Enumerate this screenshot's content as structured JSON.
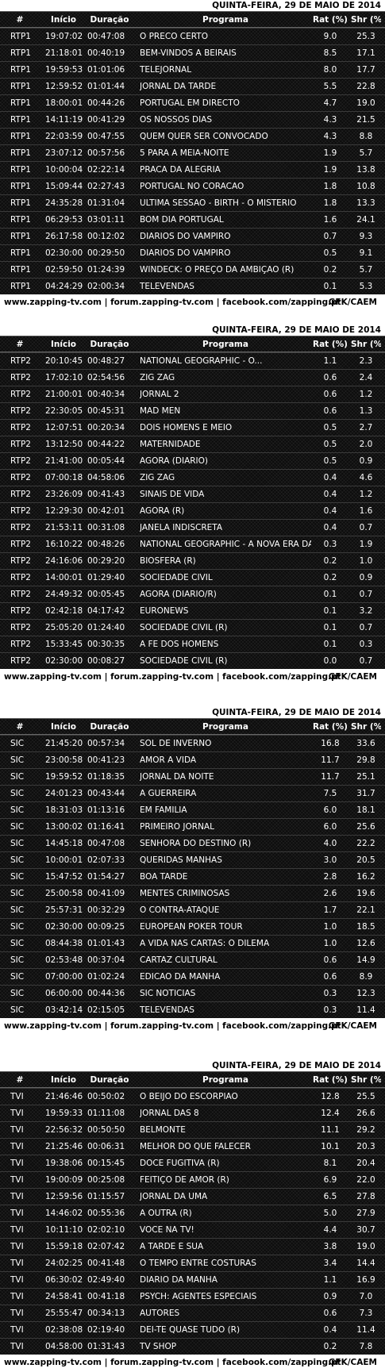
{
  "columns": {
    "num": "#",
    "inicio": "Início",
    "duracao": "Duração",
    "programa": "Programa",
    "rat": "Rat (%)",
    "shr": "Shr (%)"
  },
  "footer": {
    "links": "www.zapping-tv.com | forum.zapping-tv.com | facebook.com/zapping.pt",
    "source": "GFK/CAEM"
  },
  "blocks": [
    {
      "date": "QUINTA-FEIRA, 29 DE MAIO DE 2014",
      "rows": [
        {
          "ch": "RTP1",
          "in": "19:07:02",
          "du": "00:47:08",
          "pr": "O PRECO CERTO",
          "ra": "9.0",
          "sh": "25.3"
        },
        {
          "ch": "RTP1",
          "in": "21:18:01",
          "du": "00:40:19",
          "pr": "BEM-VINDOS A BEIRAIS",
          "ra": "8.5",
          "sh": "17.1"
        },
        {
          "ch": "RTP1",
          "in": "19:59:53",
          "du": "01:01:06",
          "pr": "TELEJORNAL",
          "ra": "8.0",
          "sh": "17.7"
        },
        {
          "ch": "RTP1",
          "in": "12:59:52",
          "du": "01:01:44",
          "pr": "JORNAL DA TARDE",
          "ra": "5.5",
          "sh": "22.8"
        },
        {
          "ch": "RTP1",
          "in": "18:00:01",
          "du": "00:44:26",
          "pr": "PORTUGAL EM DIRECTO",
          "ra": "4.7",
          "sh": "19.0"
        },
        {
          "ch": "RTP1",
          "in": "14:11:19",
          "du": "00:41:29",
          "pr": "OS NOSSOS DIAS",
          "ra": "4.3",
          "sh": "21.5"
        },
        {
          "ch": "RTP1",
          "in": "22:03:59",
          "du": "00:47:55",
          "pr": "QUEM QUER SER CONVOCADO",
          "ra": "4.3",
          "sh": "8.8"
        },
        {
          "ch": "RTP1",
          "in": "23:07:12",
          "du": "00:57:56",
          "pr": "5 PARA A MEIA-NOITE",
          "ra": "1.9",
          "sh": "5.7"
        },
        {
          "ch": "RTP1",
          "in": "10:00:04",
          "du": "02:22:14",
          "pr": "PRACA DA ALEGRIA",
          "ra": "1.9",
          "sh": "13.8"
        },
        {
          "ch": "RTP1",
          "in": "15:09:44",
          "du": "02:27:43",
          "pr": "PORTUGAL NO CORACAO",
          "ra": "1.8",
          "sh": "10.8"
        },
        {
          "ch": "RTP1",
          "in": "24:35:28",
          "du": "01:31:04",
          "pr": "ULTIMA SESSAO - BIRTH - O MISTERIO",
          "ra": "1.8",
          "sh": "13.3"
        },
        {
          "ch": "RTP1",
          "in": "06:29:53",
          "du": "03:01:11",
          "pr": "BOM DIA PORTUGAL",
          "ra": "1.6",
          "sh": "24.1"
        },
        {
          "ch": "RTP1",
          "in": "26:17:58",
          "du": "00:12:02",
          "pr": "DIARIOS DO VAMPIRO",
          "ra": "0.7",
          "sh": "9.3"
        },
        {
          "ch": "RTP1",
          "in": "02:30:00",
          "du": "00:29:50",
          "pr": "DIARIOS DO VAMPIRO",
          "ra": "0.5",
          "sh": "9.1"
        },
        {
          "ch": "RTP1",
          "in": "02:59:50",
          "du": "01:24:39",
          "pr": "WINDECK: O PREÇO DA AMBIÇAO (R)",
          "ra": "0.2",
          "sh": "5.7"
        },
        {
          "ch": "RTP1",
          "in": "04:24:29",
          "du": "02:00:34",
          "pr": "TELEVENDAS",
          "ra": "0.1",
          "sh": "5.3"
        }
      ]
    },
    {
      "date": "QUINTA-FEIRA, 29 DE MAIO DE 2014",
      "rows": [
        {
          "ch": "RTP2",
          "in": "20:10:45",
          "du": "00:48:27",
          "pr": "NATIONAL GEOGRAPHIC - O...",
          "ra": "1.1",
          "sh": "2.3"
        },
        {
          "ch": "RTP2",
          "in": "17:02:10",
          "du": "02:54:56",
          "pr": "ZIG ZAG",
          "ra": "0.6",
          "sh": "2.4"
        },
        {
          "ch": "RTP2",
          "in": "21:00:01",
          "du": "00:40:34",
          "pr": "JORNAL 2",
          "ra": "0.6",
          "sh": "1.2"
        },
        {
          "ch": "RTP2",
          "in": "22:30:05",
          "du": "00:45:31",
          "pr": "MAD MEN",
          "ra": "0.6",
          "sh": "1.3"
        },
        {
          "ch": "RTP2",
          "in": "12:07:51",
          "du": "00:20:34",
          "pr": "DOIS HOMENS E MEIO",
          "ra": "0.5",
          "sh": "2.7"
        },
        {
          "ch": "RTP2",
          "in": "13:12:50",
          "du": "00:44:22",
          "pr": "MATERNIDADE",
          "ra": "0.5",
          "sh": "2.0"
        },
        {
          "ch": "RTP2",
          "in": "21:41:00",
          "du": "00:05:44",
          "pr": "AGORA (DIARIO)",
          "ra": "0.5",
          "sh": "0.9"
        },
        {
          "ch": "RTP2",
          "in": "07:00:18",
          "du": "04:58:06",
          "pr": "ZIG ZAG",
          "ra": "0.4",
          "sh": "4.6"
        },
        {
          "ch": "RTP2",
          "in": "23:26:09",
          "du": "00:41:43",
          "pr": "SINAIS DE VIDA",
          "ra": "0.4",
          "sh": "1.2"
        },
        {
          "ch": "RTP2",
          "in": "12:29:30",
          "du": "00:42:01",
          "pr": "AGORA (R)",
          "ra": "0.4",
          "sh": "1.6"
        },
        {
          "ch": "RTP2",
          "in": "21:53:11",
          "du": "00:31:08",
          "pr": "JANELA INDISCRETA",
          "ra": "0.4",
          "sh": "0.7"
        },
        {
          "ch": "RTP2",
          "in": "16:10:22",
          "du": "00:48:26",
          "pr": "NATIONAL GEOGRAPHIC - A NOVA ERA DA",
          "ra": "0.3",
          "sh": "1.9"
        },
        {
          "ch": "RTP2",
          "in": "24:16:06",
          "du": "00:29:20",
          "pr": "BIOSFERA (R)",
          "ra": "0.2",
          "sh": "1.0"
        },
        {
          "ch": "RTP2",
          "in": "14:00:01",
          "du": "01:29:40",
          "pr": "SOCIEDADE CIVIL",
          "ra": "0.2",
          "sh": "0.9"
        },
        {
          "ch": "RTP2",
          "in": "24:49:32",
          "du": "00:05:45",
          "pr": "AGORA (DIARIO/R)",
          "ra": "0.1",
          "sh": "0.7"
        },
        {
          "ch": "RTP2",
          "in": "02:42:18",
          "du": "04:17:42",
          "pr": "EURONEWS",
          "ra": "0.1",
          "sh": "3.2"
        },
        {
          "ch": "RTP2",
          "in": "25:05:20",
          "du": "01:24:40",
          "pr": "SOCIEDADE CIVIL (R)",
          "ra": "0.1",
          "sh": "0.7"
        },
        {
          "ch": "RTP2",
          "in": "15:33:45",
          "du": "00:30:35",
          "pr": "A FE DOS HOMENS",
          "ra": "0.1",
          "sh": "0.3"
        },
        {
          "ch": "RTP2",
          "in": "02:30:00",
          "du": "00:08:27",
          "pr": "SOCIEDADE CIVIL (R)",
          "ra": "0.0",
          "sh": "0.7"
        }
      ]
    },
    {
      "date": "QUINTA-FEIRA, 29 DE MAIO DE 2014",
      "rows": [
        {
          "ch": "SIC",
          "in": "21:45:20",
          "du": "00:57:34",
          "pr": "SOL DE INVERNO",
          "ra": "16.8",
          "sh": "33.6"
        },
        {
          "ch": "SIC",
          "in": "23:00:58",
          "du": "00:41:23",
          "pr": "AMOR A VIDA",
          "ra": "11.7",
          "sh": "29.8"
        },
        {
          "ch": "SIC",
          "in": "19:59:52",
          "du": "01:18:35",
          "pr": "JORNAL DA NOITE",
          "ra": "11.7",
          "sh": "25.1"
        },
        {
          "ch": "SIC",
          "in": "24:01:23",
          "du": "00:43:44",
          "pr": "A GUERREIRA",
          "ra": "7.5",
          "sh": "31.7"
        },
        {
          "ch": "SIC",
          "in": "18:31:03",
          "du": "01:13:16",
          "pr": "EM FAMILIA",
          "ra": "6.0",
          "sh": "18.1"
        },
        {
          "ch": "SIC",
          "in": "13:00:02",
          "du": "01:16:41",
          "pr": "PRIMEIRO JORNAL",
          "ra": "6.0",
          "sh": "25.6"
        },
        {
          "ch": "SIC",
          "in": "14:45:18",
          "du": "00:47:08",
          "pr": "SENHORA DO DESTINO (R)",
          "ra": "4.0",
          "sh": "22.2"
        },
        {
          "ch": "SIC",
          "in": "10:00:01",
          "du": "02:07:33",
          "pr": "QUERIDAS MANHAS",
          "ra": "3.0",
          "sh": "20.5"
        },
        {
          "ch": "SIC",
          "in": "15:47:52",
          "du": "01:54:27",
          "pr": "BOA TARDE",
          "ra": "2.8",
          "sh": "16.2"
        },
        {
          "ch": "SIC",
          "in": "25:00:58",
          "du": "00:41:09",
          "pr": "MENTES CRIMINOSAS",
          "ra": "2.6",
          "sh": "19.6"
        },
        {
          "ch": "SIC",
          "in": "25:57:31",
          "du": "00:32:29",
          "pr": "O CONTRA-ATAQUE",
          "ra": "1.7",
          "sh": "22.1"
        },
        {
          "ch": "SIC",
          "in": "02:30:00",
          "du": "00:09:25",
          "pr": "EUROPEAN POKER TOUR",
          "ra": "1.0",
          "sh": "18.5"
        },
        {
          "ch": "SIC",
          "in": "08:44:38",
          "du": "01:01:43",
          "pr": "A VIDA NAS CARTAS: O DILEMA",
          "ra": "1.0",
          "sh": "12.6"
        },
        {
          "ch": "SIC",
          "in": "02:53:48",
          "du": "00:37:04",
          "pr": "CARTAZ CULTURAL",
          "ra": "0.6",
          "sh": "14.9"
        },
        {
          "ch": "SIC",
          "in": "07:00:00",
          "du": "01:02:24",
          "pr": "EDICAO DA MANHA",
          "ra": "0.6",
          "sh": "8.9"
        },
        {
          "ch": "SIC",
          "in": "06:00:00",
          "du": "00:44:36",
          "pr": "SIC NOTICIAS",
          "ra": "0.3",
          "sh": "12.3"
        },
        {
          "ch": "SIC",
          "in": "03:42:14",
          "du": "02:15:05",
          "pr": "TELEVENDAS",
          "ra": "0.3",
          "sh": "11.4"
        }
      ]
    },
    {
      "date": "QUINTA-FEIRA, 29 DE MAIO DE 2014",
      "rows": [
        {
          "ch": "TVI",
          "in": "21:46:46",
          "du": "00:50:02",
          "pr": "O BEIJO DO ESCORPIAO",
          "ra": "12.8",
          "sh": "25.5"
        },
        {
          "ch": "TVI",
          "in": "19:59:33",
          "du": "01:11:08",
          "pr": "JORNAL DAS 8",
          "ra": "12.4",
          "sh": "26.6"
        },
        {
          "ch": "TVI",
          "in": "22:56:32",
          "du": "00:50:50",
          "pr": "BELMONTE",
          "ra": "11.1",
          "sh": "29.2"
        },
        {
          "ch": "TVI",
          "in": "21:25:46",
          "du": "00:06:31",
          "pr": "MELHOR DO QUE FALECER",
          "ra": "10.1",
          "sh": "20.3"
        },
        {
          "ch": "TVI",
          "in": "19:38:06",
          "du": "00:15:45",
          "pr": "DOCE FUGITIVA (R)",
          "ra": "8.1",
          "sh": "20.4"
        },
        {
          "ch": "TVI",
          "in": "19:00:09",
          "du": "00:25:08",
          "pr": "FEITIÇO DE AMOR (R)",
          "ra": "6.9",
          "sh": "22.0"
        },
        {
          "ch": "TVI",
          "in": "12:59:56",
          "du": "01:15:57",
          "pr": "JORNAL DA UMA",
          "ra": "6.5",
          "sh": "27.8"
        },
        {
          "ch": "TVI",
          "in": "14:46:02",
          "du": "00:55:36",
          "pr": "A OUTRA (R)",
          "ra": "5.0",
          "sh": "27.9"
        },
        {
          "ch": "TVI",
          "in": "10:11:10",
          "du": "02:02:10",
          "pr": "VOCE NA TV!",
          "ra": "4.4",
          "sh": "30.7"
        },
        {
          "ch": "TVI",
          "in": "15:59:18",
          "du": "02:07:42",
          "pr": "A TARDE E SUA",
          "ra": "3.8",
          "sh": "19.0"
        },
        {
          "ch": "TVI",
          "in": "24:02:25",
          "du": "00:41:48",
          "pr": "O TEMPO ENTRE COSTURAS",
          "ra": "3.4",
          "sh": "14.4"
        },
        {
          "ch": "TVI",
          "in": "06:30:02",
          "du": "02:49:40",
          "pr": "DIARIO DA MANHA",
          "ra": "1.1",
          "sh": "16.9"
        },
        {
          "ch": "TVI",
          "in": "24:58:41",
          "du": "00:41:18",
          "pr": "PSYCH: AGENTES ESPECIAIS",
          "ra": "0.9",
          "sh": "7.0"
        },
        {
          "ch": "TVI",
          "in": "25:55:47",
          "du": "00:34:13",
          "pr": "AUTORES",
          "ra": "0.6",
          "sh": "7.3"
        },
        {
          "ch": "TVI",
          "in": "02:38:08",
          "du": "02:19:40",
          "pr": "DEI-TE QUASE TUDO (R)",
          "ra": "0.4",
          "sh": "11.4"
        },
        {
          "ch": "TVI",
          "in": "04:58:00",
          "du": "01:31:43",
          "pr": "TV SHOP",
          "ra": "0.2",
          "sh": "7.8"
        }
      ]
    }
  ]
}
